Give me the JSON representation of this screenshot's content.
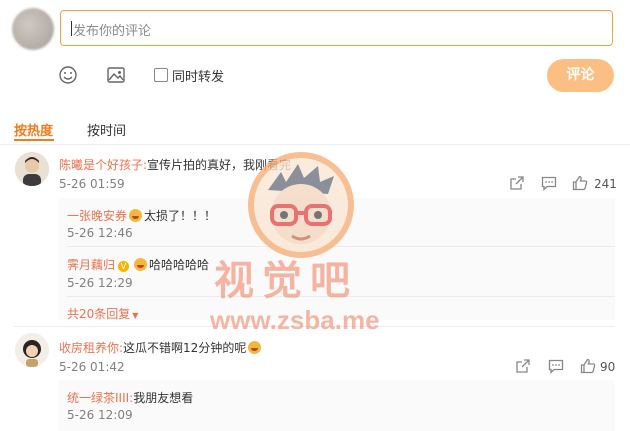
{
  "composer": {
    "placeholder": "发布你的评论",
    "repost_label": "同时转发",
    "submit_label": "评论"
  },
  "sort": {
    "hot_label": "按热度",
    "time_label": "按时间"
  },
  "comments": [
    {
      "author": "陈曦是个好孩子:",
      "text": "宣传片拍的真好，我刚看完",
      "time": "5-26 01:59",
      "likes": "241",
      "replies": [
        {
          "author": "一张晚安券",
          "text": "太损了！！！",
          "time": "5-26 12:46"
        },
        {
          "author": "霁月藕归",
          "text": "哈哈哈哈哈",
          "time": "5-26 12:29"
        }
      ],
      "more_replies": "共20条回复"
    },
    {
      "author": "收房租养你:",
      "text": "这瓜不错啊12分钟的呢",
      "time": "5-26 01:42",
      "likes": "90",
      "replies": [
        {
          "author": "统一绿茶IIII:",
          "text": "我朋友想看",
          "time": "5-26 12:09"
        }
      ]
    }
  ],
  "watermark": {
    "title": "视觉吧",
    "url": "www.zsba.me"
  },
  "colors": {
    "accent": "#f37b1d",
    "author": "#eb7350",
    "submit_bg": "#fbbf83",
    "input_border": "#f0a43a"
  }
}
